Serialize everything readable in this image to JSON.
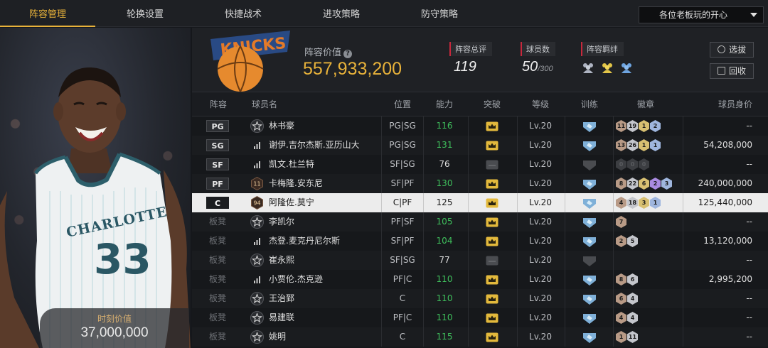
{
  "nav": {
    "tabs": [
      "阵容管理",
      "轮换设置",
      "快捷战术",
      "进攻策略",
      "防守策略"
    ],
    "active_tab": 0,
    "dropdown_value": "各位老板玩的开心"
  },
  "player_card": {
    "jersey_text": "CHARLOTTE",
    "jersey_number": "33",
    "value_label": "时刻价值",
    "value": "37,000,000"
  },
  "summary": {
    "lineup_value_label": "阵容价值",
    "lineup_value": "557,933,200",
    "overall_label": "阵容总评",
    "overall_value": "119",
    "count_label": "球员数",
    "count_value": "50",
    "count_max": "/300",
    "synergy_label": "阵容羁绊",
    "synergy_icons": [
      "team-icon",
      "team-icon",
      "team-icon"
    ],
    "select_button": "选拔",
    "recycle_button": "回收"
  },
  "table": {
    "headers": {
      "lineup": "阵容",
      "name": "球员名",
      "position": "位置",
      "ability": "能力",
      "breakthrough": "突破",
      "level": "等级",
      "training": "训练",
      "badges": "徽章",
      "value": "球员身价"
    },
    "rows": [
      {
        "slot": "PG",
        "starter": true,
        "num_icon": "star",
        "name": "林书豪",
        "pos": "PG|SG",
        "ability": "116",
        "boosted": true,
        "level": "Lv.20",
        "badges": [
          [
            "bronze",
            "11"
          ],
          [
            "silver",
            "19"
          ],
          [
            "gold",
            "1"
          ],
          [
            "blue",
            "2"
          ]
        ],
        "value": "--"
      },
      {
        "slot": "SG",
        "starter": true,
        "num_icon": "bars",
        "name": "谢伊.吉尔杰斯.亚历山大",
        "pos": "PG|SG",
        "ability": "131",
        "boosted": true,
        "level": "Lv.20",
        "badges": [
          [
            "bronze",
            "13"
          ],
          [
            "silver",
            "26"
          ],
          [
            "gold",
            "1"
          ],
          [
            "blue",
            "1"
          ]
        ],
        "value": "54,208,000"
      },
      {
        "slot": "SF",
        "starter": true,
        "num_icon": "bars",
        "name": "凯文.杜兰特",
        "pos": "SF|SG",
        "ability": "76",
        "boosted": false,
        "level": "Lv.20",
        "badges": [
          [
            "dim",
            "0"
          ],
          [
            "dim",
            "0"
          ],
          [
            "dim",
            "0"
          ]
        ],
        "value": "--"
      },
      {
        "slot": "PF",
        "starter": true,
        "num_icon": "11",
        "name": "卡梅隆.安东尼",
        "pos": "SF|PF",
        "ability": "130",
        "boosted": true,
        "level": "Lv.20",
        "badges": [
          [
            "bronze",
            "8"
          ],
          [
            "silver",
            "22"
          ],
          [
            "gold",
            "6"
          ],
          [
            "purple",
            "2"
          ],
          [
            "blue",
            "3"
          ]
        ],
        "value": "240,000,000"
      },
      {
        "slot": "C",
        "starter": true,
        "selected": true,
        "num_icon": "94",
        "name": "阿隆佐.莫宁",
        "pos": "C|PF",
        "ability": "125",
        "boosted": true,
        "level": "Lv.20",
        "badges": [
          [
            "bronze",
            "4"
          ],
          [
            "silver",
            "18"
          ],
          [
            "gold",
            "3"
          ],
          [
            "blue",
            "1"
          ]
        ],
        "value": "125,440,000"
      },
      {
        "slot": "板凳",
        "starter": false,
        "num_icon": "star",
        "name": "李凯尔",
        "pos": "PF|SF",
        "ability": "105",
        "boosted": true,
        "level": "Lv.20",
        "badges": [
          [
            "bronze",
            "7"
          ]
        ],
        "value": "--"
      },
      {
        "slot": "板凳",
        "starter": false,
        "num_icon": "bars",
        "name": "杰登.麦克丹尼尔斯",
        "pos": "SF|PF",
        "ability": "104",
        "boosted": true,
        "level": "Lv.20",
        "badges": [
          [
            "bronze",
            "2"
          ],
          [
            "silver",
            "5"
          ]
        ],
        "value": "13,120,000"
      },
      {
        "slot": "板凳",
        "starter": false,
        "num_icon": "star",
        "name": "崔永熙",
        "pos": "SF|SG",
        "ability": "77",
        "boosted": false,
        "level": "Lv.20",
        "badges": [],
        "value": "--"
      },
      {
        "slot": "板凳",
        "starter": false,
        "num_icon": "bars",
        "name": "小贾伦.杰克逊",
        "pos": "PF|C",
        "ability": "110",
        "boosted": true,
        "level": "Lv.20",
        "badges": [
          [
            "bronze",
            "8"
          ],
          [
            "silver",
            "6"
          ]
        ],
        "value": "2,995,200"
      },
      {
        "slot": "板凳",
        "starter": false,
        "num_icon": "star",
        "name": "王治郅",
        "pos": "C",
        "ability": "110",
        "boosted": true,
        "level": "Lv.20",
        "badges": [
          [
            "bronze",
            "6"
          ],
          [
            "silver",
            "4"
          ]
        ],
        "value": "--"
      },
      {
        "slot": "板凳",
        "starter": false,
        "num_icon": "star",
        "name": "易建联",
        "pos": "PF|C",
        "ability": "110",
        "boosted": true,
        "level": "Lv.20",
        "badges": [
          [
            "bronze",
            "4"
          ],
          [
            "silver",
            "4"
          ]
        ],
        "value": "--"
      },
      {
        "slot": "板凳",
        "starter": false,
        "num_icon": "star",
        "name": "姚明",
        "pos": "C",
        "ability": "115",
        "boosted": true,
        "level": "Lv.20",
        "badges": [
          [
            "bronze",
            "1"
          ],
          [
            "silver",
            "11"
          ]
        ],
        "value": "--"
      }
    ]
  },
  "colors": {
    "accent_gold": "#e8b23a",
    "ability_green": "#3fbf5c",
    "label_red": "#c8283c",
    "training_blue": "#7fb0d8"
  }
}
